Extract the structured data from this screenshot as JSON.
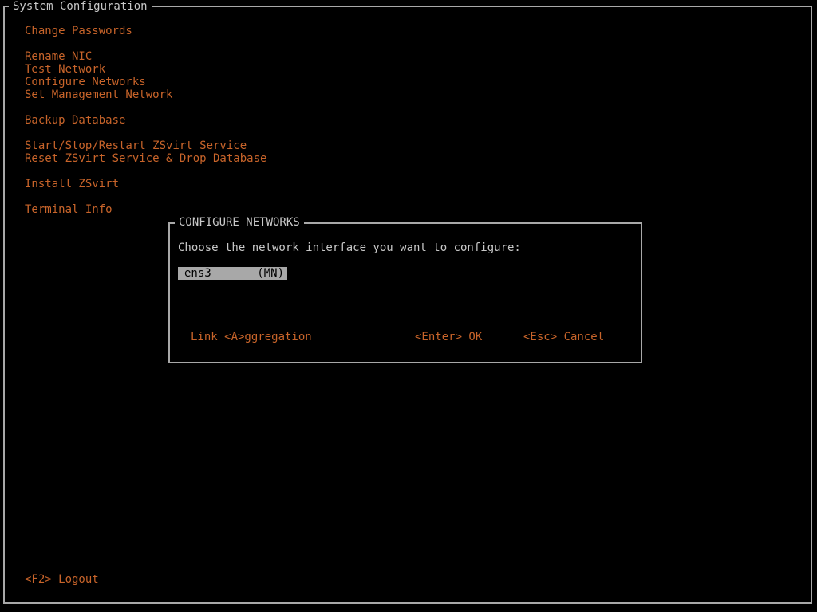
{
  "window": {
    "title": "System Configuration"
  },
  "menu": {
    "items": [
      {
        "label": "Change Passwords"
      },
      {
        "label": "Rename NIC"
      },
      {
        "label": "Test Network"
      },
      {
        "label": "Configure Networks"
      },
      {
        "label": "Set Management Network"
      },
      {
        "label": "Backup Database"
      },
      {
        "label": "Start/Stop/Restart ZSvirt Service"
      },
      {
        "label": "Reset ZSvirt Service & Drop Database"
      },
      {
        "label": "Install ZSvirt"
      },
      {
        "label": "Terminal Info"
      }
    ]
  },
  "footer": {
    "logout_label": "<F2> Logout"
  },
  "dialog": {
    "title": "CONFIGURE NETWORKS",
    "prompt": "Choose the network interface you want to configure:",
    "interfaces": [
      {
        "name": "ens3",
        "tag": "(MN)",
        "selected": true
      }
    ],
    "buttons": {
      "aggregation": "Link <A>ggregation",
      "ok": "<Enter> OK",
      "cancel": "<Esc> Cancel"
    }
  },
  "colors": {
    "background": "#000000",
    "menu_text": "#c8642a",
    "border": "#a8a8a8",
    "dialog_text": "#c8c8c8",
    "selection_bg": "#a8a8a8"
  }
}
